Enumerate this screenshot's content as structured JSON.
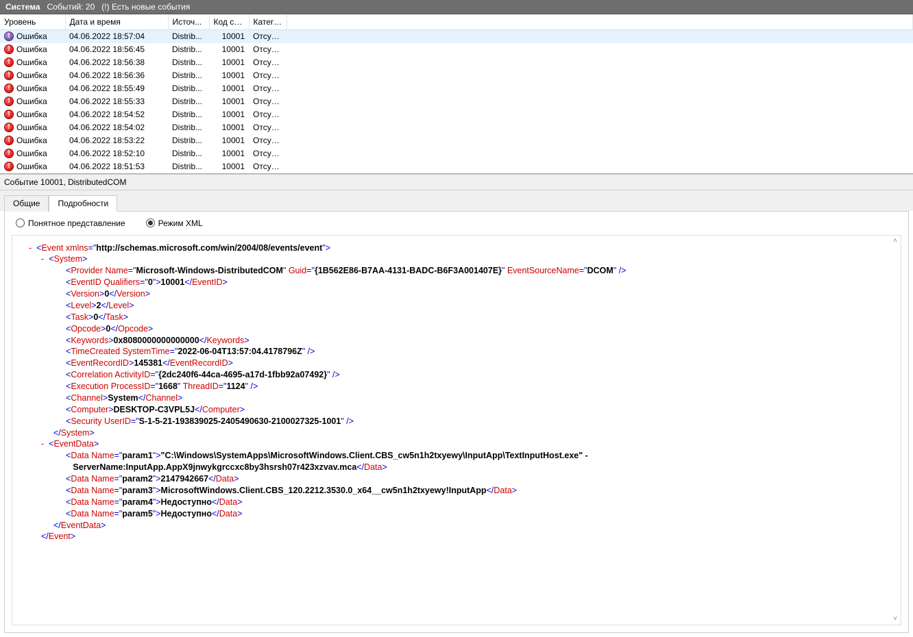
{
  "titlebar": {
    "system": "Система",
    "events_label": "Событий: 20",
    "new_events": "(!) Есть новые события"
  },
  "columns": {
    "level": "Уровень",
    "date": "Дата и время",
    "source": "Источ...",
    "code": "Код со...",
    "category": "Катего..."
  },
  "rows": [
    {
      "level": "Ошибка",
      "date": "04.06.2022 18:57:04",
      "source": "Distrib...",
      "code": "10001",
      "cat": "Отсутс...",
      "selected": true
    },
    {
      "level": "Ошибка",
      "date": "04.06.2022 18:56:45",
      "source": "Distrib...",
      "code": "10001",
      "cat": "Отсутс..."
    },
    {
      "level": "Ошибка",
      "date": "04.06.2022 18:56:38",
      "source": "Distrib...",
      "code": "10001",
      "cat": "Отсутс..."
    },
    {
      "level": "Ошибка",
      "date": "04.06.2022 18:56:36",
      "source": "Distrib...",
      "code": "10001",
      "cat": "Отсутс..."
    },
    {
      "level": "Ошибка",
      "date": "04.06.2022 18:55:49",
      "source": "Distrib...",
      "code": "10001",
      "cat": "Отсутс..."
    },
    {
      "level": "Ошибка",
      "date": "04.06.2022 18:55:33",
      "source": "Distrib...",
      "code": "10001",
      "cat": "Отсутс..."
    },
    {
      "level": "Ошибка",
      "date": "04.06.2022 18:54:52",
      "source": "Distrib...",
      "code": "10001",
      "cat": "Отсутс..."
    },
    {
      "level": "Ошибка",
      "date": "04.06.2022 18:54:02",
      "source": "Distrib...",
      "code": "10001",
      "cat": "Отсутс..."
    },
    {
      "level": "Ошибка",
      "date": "04.06.2022 18:53:22",
      "source": "Distrib...",
      "code": "10001",
      "cat": "Отсутс..."
    },
    {
      "level": "Ошибка",
      "date": "04.06.2022 18:52:10",
      "source": "Distrib...",
      "code": "10001",
      "cat": "Отсутс..."
    },
    {
      "level": "Ошибка",
      "date": "04.06.2022 18:51:53",
      "source": "Distrib...",
      "code": "10001",
      "cat": "Отсутс..."
    }
  ],
  "detail_header": "Событие 10001, DistributedCOM",
  "tabs": {
    "general": "Общие",
    "details": "Подробности"
  },
  "radios": {
    "friendly": "Понятное представление",
    "xml": "Режим XML"
  },
  "xml": {
    "event_xmlns": "http://schemas.microsoft.com/win/2004/08/events/event",
    "provider_name": "Microsoft-Windows-DistributedCOM",
    "provider_guid": "{1B562E86-B7AA-4131-BADC-B6F3A001407E}",
    "provider_source": "DCOM",
    "eventid_qualifiers": "0",
    "eventid": "10001",
    "version": "0",
    "level": "2",
    "task": "0",
    "opcode": "0",
    "keywords": "0x8080000000000000",
    "timecreated": "2022-06-04T13:57:04.4178796Z",
    "eventrecordid": "145381",
    "correlation_activityid": "{2dc240f6-44ca-4695-a17d-1fbb92a07492}",
    "execution_processid": "1668",
    "execution_threadid": "1124",
    "channel": "System",
    "computer": "DESKTOP-C3VPL5J",
    "security_userid": "S-1-5-21-193839025-2405490630-2100027325-1001",
    "param1_a": "\"C:\\Windows\\SystemApps\\MicrosoftWindows.Client.CBS_cw5n1h2txyewy\\InputApp\\TextInputHost.exe\" -",
    "param1_b": "ServerName:InputApp.AppX9jnwykgrccxc8by3hsrsh07r423xzvav.mca",
    "param2": "2147942667",
    "param3": "MicrosoftWindows.Client.CBS_120.2212.3530.0_x64__cw5n1h2txyewy!InputApp",
    "param4": "Недоступно",
    "param5": "Недоступно"
  }
}
